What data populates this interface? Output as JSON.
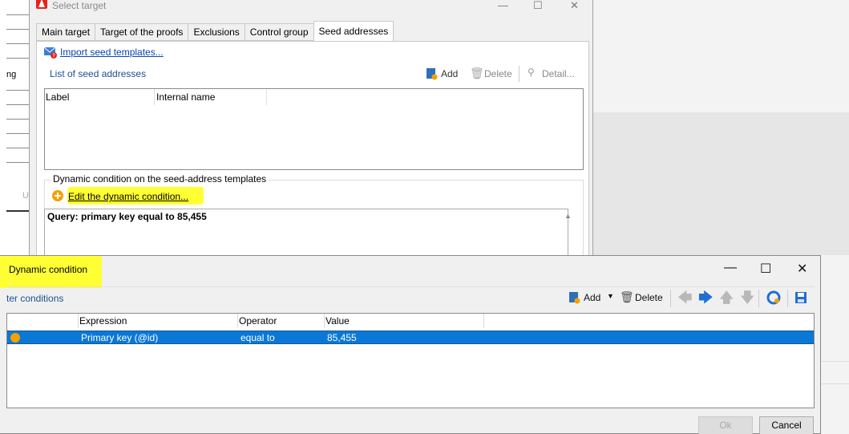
{
  "background": {
    "left_label_1": "ng",
    "left_label_2": "U"
  },
  "select_target": {
    "title": "Select target",
    "tabs": [
      "Main target",
      "Target of the proofs",
      "Exclusions",
      "Control group",
      "Seed addresses"
    ],
    "active_tab": "Seed addresses",
    "import_link": "Import seed templates...",
    "list_title": "List of seed addresses",
    "toolbar": {
      "add": "Add",
      "delete": "Delete",
      "detail": "Detail..."
    },
    "columns": [
      "Label",
      "Internal name"
    ],
    "dynamic_group_label": "Dynamic condition on the seed-address templates",
    "edit_link": "Edit the dynamic condition...",
    "query": "Query: primary key equal to 85,455"
  },
  "dynamic_condition": {
    "title": "Dynamic condition",
    "filter_label": "ter conditions",
    "toolbar": {
      "add": "Add",
      "delete": "Delete"
    },
    "columns": [
      "Expression",
      "Operator",
      "Value"
    ],
    "rows": [
      {
        "expression": "Primary key (@id)",
        "operator": "equal to",
        "value": "85,455"
      }
    ],
    "ok_label": "Ok",
    "cancel_label": "Cancel"
  },
  "colors": {
    "selection": "#0a78d7",
    "highlight": "#ffff33",
    "link": "#0645ad",
    "row_icon": "#f4a000"
  }
}
